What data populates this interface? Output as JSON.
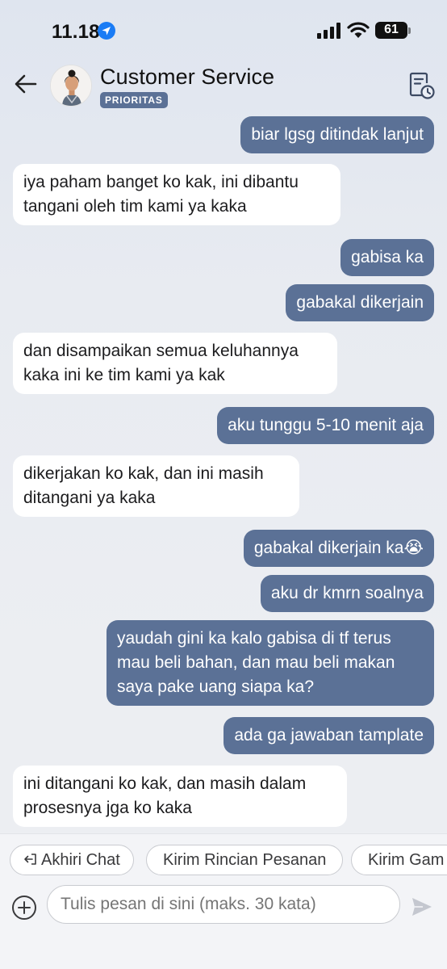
{
  "status": {
    "time": "11.18",
    "battery": "61"
  },
  "header": {
    "title": "Customer Service",
    "badge": "PRIORITAS"
  },
  "messages": [
    {
      "dir": "out",
      "lines": [
        "biar lgsg ditindak lanjut"
      ]
    },
    {
      "dir": "in",
      "lines": [
        "iya paham banget ko kak, ini dibantu",
        "tangani oleh tim kami ya kaka"
      ]
    },
    {
      "dir": "out",
      "lines": [
        "gabisa ka"
      ]
    },
    {
      "dir": "out",
      "lines": [
        "gabakal dikerjain"
      ]
    },
    {
      "dir": "in",
      "lines": [
        "dan disampaikan semua keluhannya",
        "kaka ini ke tim kami ya kak"
      ]
    },
    {
      "dir": "out",
      "lines": [
        "aku tunggu 5-10 menit aja"
      ]
    },
    {
      "dir": "in",
      "lines": [
        "dikerjakan ko kak, dan ini masih",
        "ditangani ya kaka"
      ]
    },
    {
      "dir": "out",
      "lines": [
        "gabakal dikerjain ka😭"
      ]
    },
    {
      "dir": "out",
      "lines": [
        "aku dr kmrn soalnya"
      ]
    },
    {
      "dir": "out",
      "lines": [
        "yaudah gini ka kalo gabisa di tf terus",
        "mau beli bahan, dan mau beli makan",
        "saya pake uang siapa ka?"
      ]
    },
    {
      "dir": "out",
      "lines": [
        "ada ga jawaban tamplate"
      ]
    },
    {
      "dir": "in",
      "lines": [
        "ini ditangani ko kak, dan masih dalam",
        "prosesnya jga ko kaka"
      ]
    }
  ],
  "quick_replies": {
    "end_chat": "Akhiri Chat",
    "order_details": "Kirim Rincian Pesanan",
    "send_image": "Kirim Gam"
  },
  "composer": {
    "placeholder": "Tulis pesan di sini (maks. 30 kata)"
  },
  "colors": {
    "outgoing": "#5b7196",
    "incoming": "#ffffff"
  }
}
